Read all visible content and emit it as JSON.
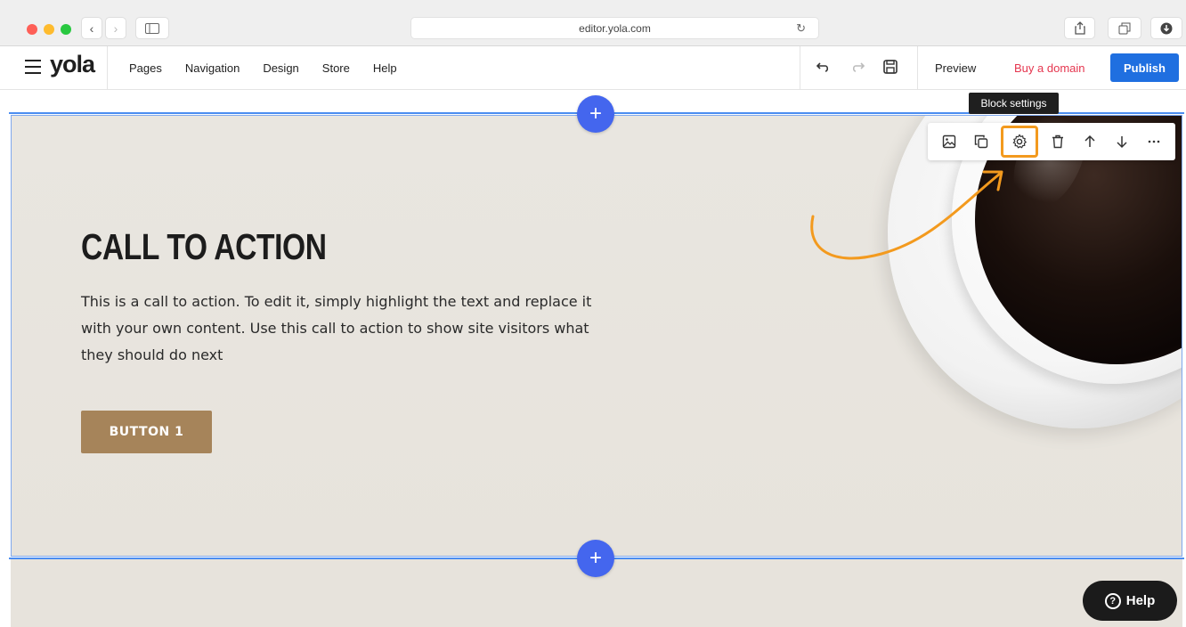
{
  "browser": {
    "url": "editor.yola.com"
  },
  "editor": {
    "logo": "yola",
    "menu": [
      {
        "label": "Pages"
      },
      {
        "label": "Navigation"
      },
      {
        "label": "Design"
      },
      {
        "label": "Store"
      },
      {
        "label": "Help"
      }
    ],
    "preview_label": "Preview",
    "buy_domain_label": "Buy a domain",
    "publish_label": "Publish",
    "accent_color": "#1f6fe0",
    "buy_domain_color": "#e5364f"
  },
  "block": {
    "title": "CALL TO ACTION",
    "body": "This is a call to action. To edit it, simply highlight the text and replace it with your own content. Use this call to action to show site visitors what they should do next",
    "button_label": "BUTTON 1",
    "button_color": "#a6845a"
  },
  "block_toolbar": {
    "tooltip": "Block settings",
    "highlight_color": "#f39a1e",
    "tools": [
      "image-icon",
      "duplicate-icon",
      "gear-icon",
      "trash-icon",
      "arrow-up-icon",
      "arrow-down-icon",
      "more-icon"
    ]
  },
  "add_button_symbol": "+",
  "help_label": "Help"
}
